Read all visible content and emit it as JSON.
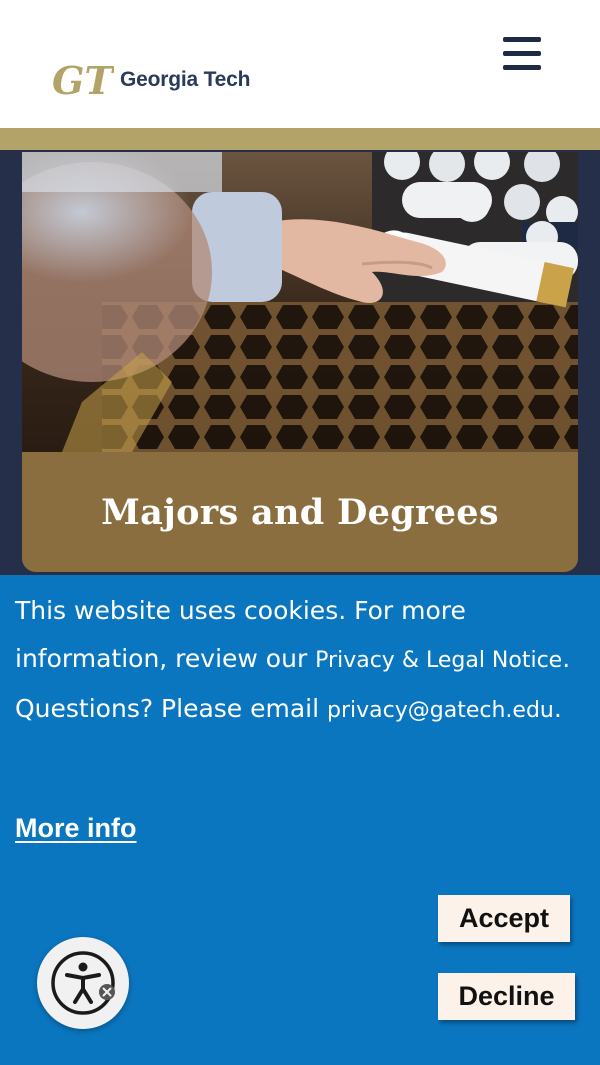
{
  "header": {
    "logo_text": "Georgia Tech",
    "logo_mark": "GT",
    "menu_icon": "hamburger-menu-icon"
  },
  "card": {
    "title": "Majors and Degrees",
    "image": "hand-picking-rolled-diploma-from-honeycomb-rack"
  },
  "cookie_banner": {
    "text_part1": "This website uses cookies. For more information, review our ",
    "privacy_link": "Privacy & Legal Notice",
    "text_part2": ". Questions? Please email ",
    "email_link": "privacy@gatech.edu",
    "text_part3": ".",
    "more_info": "More info",
    "accept_label": "Accept",
    "decline_label": "Decline"
  },
  "accessibility": {
    "icon": "accessibility-person-icon",
    "badge_icon": "close-badge-icon"
  },
  "colors": {
    "gold": "#b3a369",
    "navy": "#262f4a",
    "caption_gold": "#8b6e3f",
    "banner_blue": "#0b76c0",
    "button_bg": "#fcf2ea"
  }
}
